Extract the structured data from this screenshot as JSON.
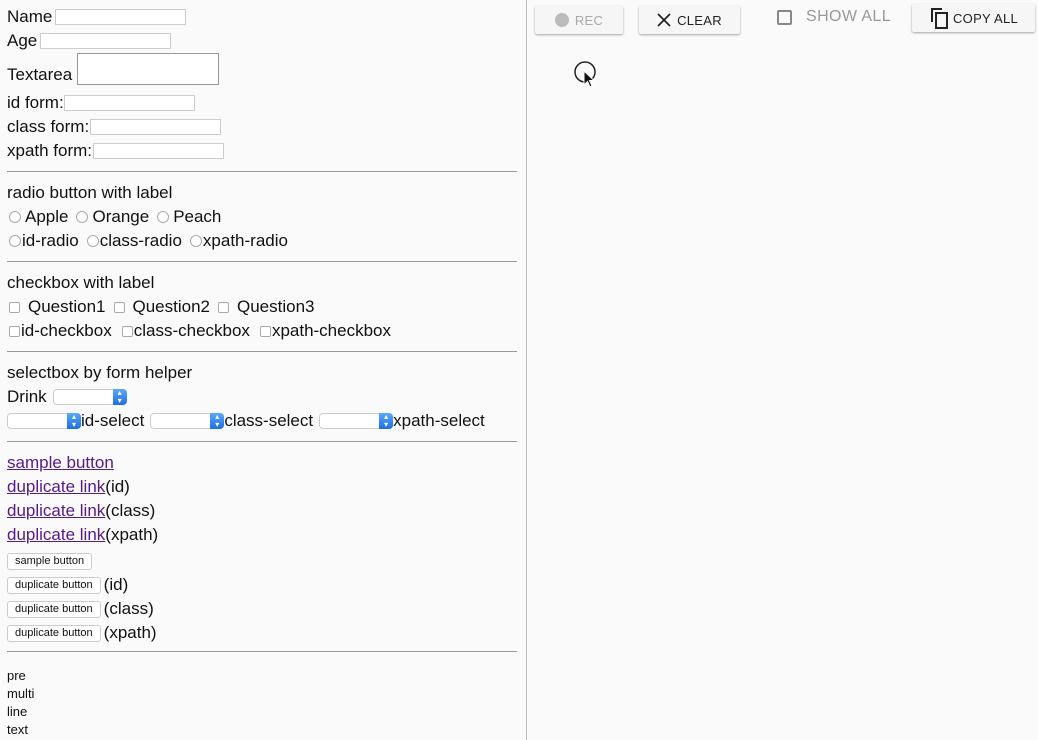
{
  "form": {
    "name_label": "Name",
    "age_label": "Age",
    "textarea_label": "Textarea",
    "id_form_label": "id form:",
    "class_form_label": "class form:",
    "xpath_form_label": "xpath form:"
  },
  "radio": {
    "heading": "radio button with label",
    "options": [
      "Apple",
      "Orange",
      "Peach"
    ],
    "locators": [
      "id-radio",
      "class-radio",
      "xpath-radio"
    ]
  },
  "checkbox": {
    "heading": "checkbox with label",
    "options": [
      "Question1",
      "Question2",
      "Question3"
    ],
    "locators": [
      "id-checkbox",
      "class-checkbox",
      "xpath-checkbox"
    ]
  },
  "select": {
    "heading": "selectbox by form helper",
    "drink_label": "Drink",
    "locators": [
      "id-select",
      "class-select",
      "xpath-select"
    ]
  },
  "links": {
    "sample_link": "sample button",
    "duplicate_link": "duplicate link",
    "suffixes": [
      "(id)",
      "(class)",
      "(xpath)"
    ]
  },
  "buttons": {
    "sample_button": "sample button",
    "duplicate_button": "duplicate button",
    "suffixes": [
      "(id)",
      "(class)",
      "(xpath)"
    ]
  },
  "pre_lines": [
    "pre",
    "multi",
    "line",
    "text"
  ],
  "toolbar": {
    "rec_label": "REC",
    "clear_label": "CLEAR",
    "show_all_label": "SHOW ALL",
    "copy_all_label": "COPY ALL"
  },
  "colors": {
    "link": "#551a8b",
    "select_arrow": "#1e6fdc"
  }
}
